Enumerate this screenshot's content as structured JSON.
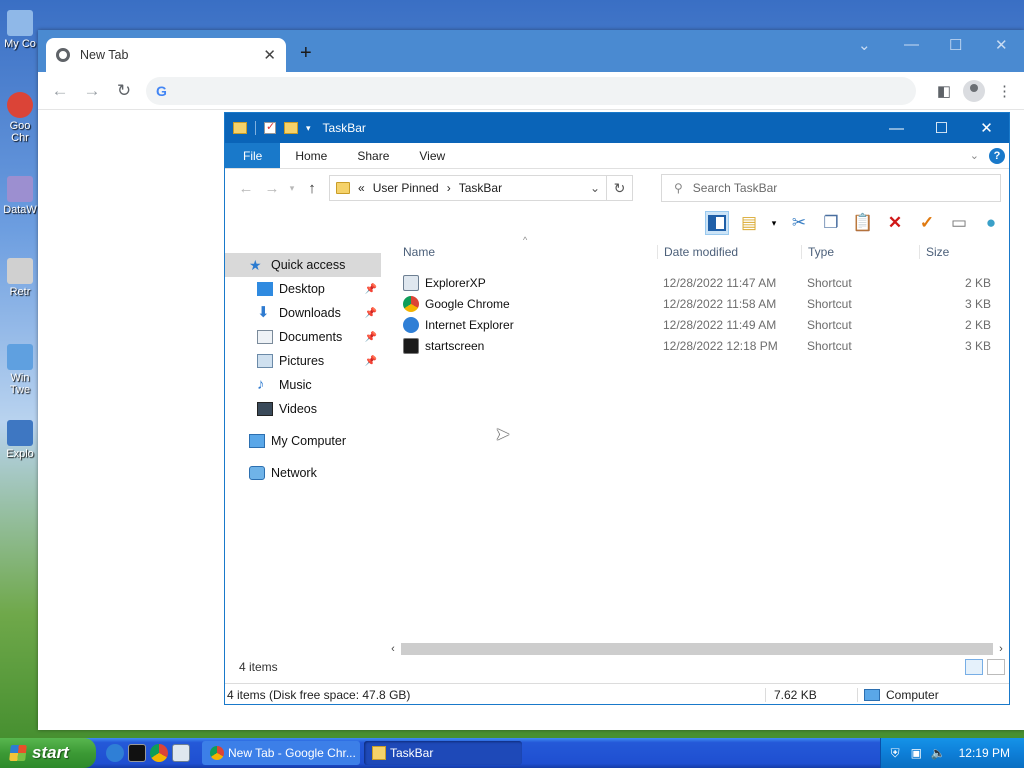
{
  "desktop": {
    "icons": [
      {
        "label": "My Co",
        "color": "#8fb8e8"
      },
      {
        "label": "Goo\nChr",
        "color": "#db4437"
      },
      {
        "label": "DataW",
        "color": "#9c8fd0"
      },
      {
        "label": "Retr",
        "color": "#d0d0d0"
      },
      {
        "label": "Win\nTwe",
        "color": "#5fa0e0"
      },
      {
        "label": "Explo",
        "color": "#3e77c2"
      }
    ]
  },
  "chrome": {
    "tab_title": "New Tab",
    "tab_close": "✕",
    "new_tab": "+",
    "omnibox_logo": "G",
    "window_controls": [
      "⌄",
      "—",
      "☐",
      "✕"
    ],
    "nav": {
      "back": "←",
      "forward": "→",
      "reload": "↻"
    },
    "toolbar_icons": [
      "side-panel-icon",
      "profile-icon",
      "menu-icon"
    ]
  },
  "explorer": {
    "title": "TaskBar",
    "controls": [
      "—",
      "☐",
      "✕"
    ],
    "ribbon_tabs": [
      "File",
      "Home",
      "Share",
      "View"
    ],
    "help": "?",
    "address": {
      "prefix": "«",
      "crumbs": [
        "User Pinned",
        "TaskBar"
      ],
      "separator": "›"
    },
    "search_placeholder": "Search TaskBar",
    "nav_pane": {
      "quick_access": "Quick access",
      "quick_items": [
        "Desktop",
        "Downloads",
        "Documents",
        "Pictures",
        "Music",
        "Videos"
      ],
      "pinned": [
        true,
        true,
        true,
        true,
        false,
        false
      ],
      "my_computer": "My Computer",
      "network": "Network"
    },
    "columns": [
      "Name",
      "Date modified",
      "Type",
      "Size"
    ],
    "files": [
      {
        "name": "ExplorerXP",
        "date": "12/28/2022 11:47 AM",
        "type": "Shortcut",
        "size": "2 KB"
      },
      {
        "name": "Google Chrome",
        "date": "12/28/2022 11:58 AM",
        "type": "Shortcut",
        "size": "3 KB"
      },
      {
        "name": "Internet Explorer",
        "date": "12/28/2022 11:49 AM",
        "type": "Shortcut",
        "size": "2 KB"
      },
      {
        "name": "startscreen",
        "date": "12/28/2022 12:18 PM",
        "type": "Shortcut",
        "size": "3 KB"
      }
    ],
    "item_count": "4 items",
    "classic_status": {
      "info": "4 items (Disk free space: 47.8 GB)",
      "size": "7.62 KB",
      "location": "Computer"
    }
  },
  "taskbar": {
    "start_label": "start",
    "tasks": [
      {
        "label": "New Tab - Google Chr...",
        "active": false
      },
      {
        "label": "TaskBar",
        "active": true
      }
    ],
    "clock": "12:19 PM",
    "colors": {
      "bar": "#2459d8",
      "start": "#3c9a35",
      "tray": "#0e7fd8"
    }
  }
}
